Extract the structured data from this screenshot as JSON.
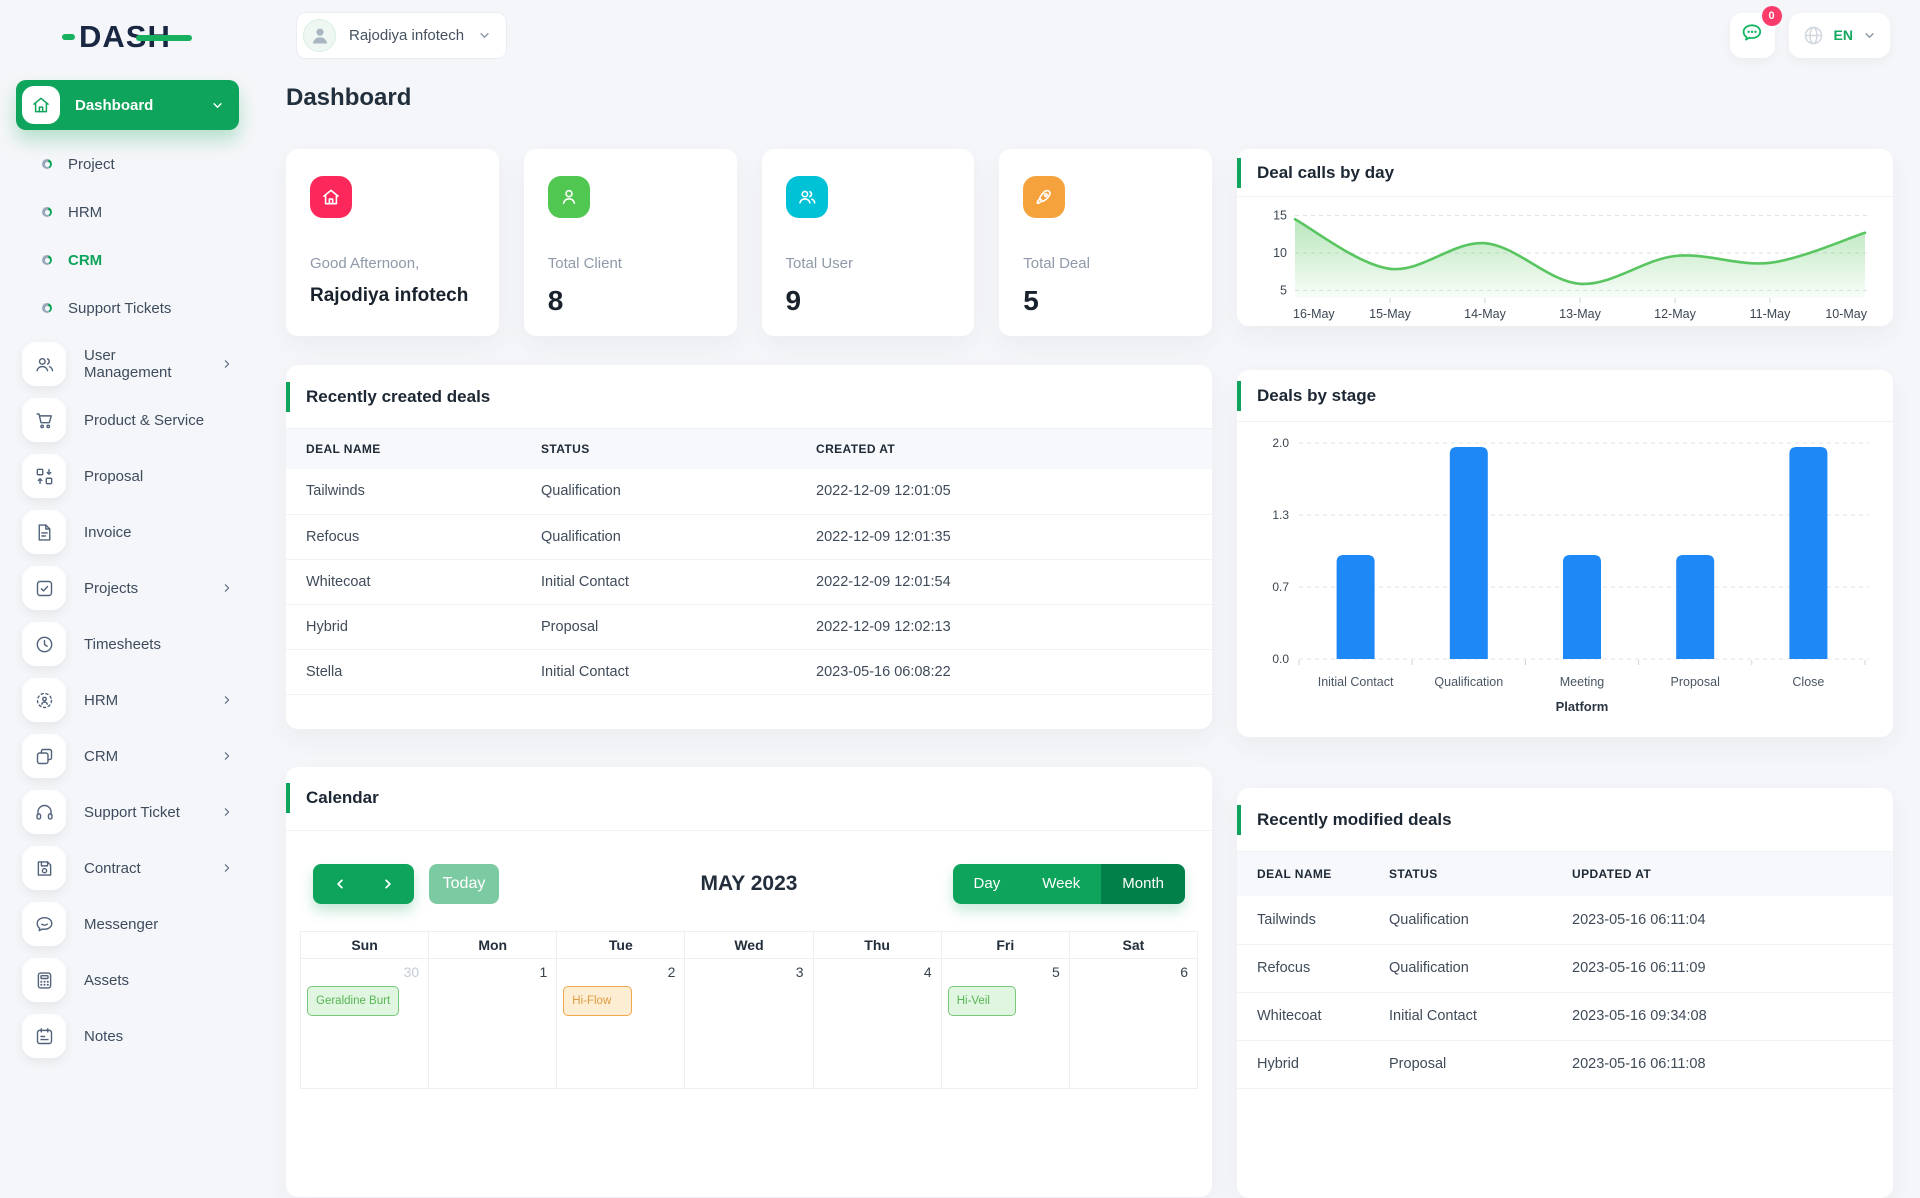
{
  "brand": {
    "logo_text": "DASH",
    "accent_color": "#17b05e",
    "text_color": "#1a2742"
  },
  "topbar": {
    "company": {
      "name": "Rajodiya infotech"
    },
    "messages_badge": "0",
    "language": {
      "code": "EN"
    }
  },
  "page": {
    "title": "Dashboard"
  },
  "sidebar": {
    "dashboard": {
      "label": "Dashboard",
      "icon": "home-icon",
      "expanded": true
    },
    "dashboard_children": [
      {
        "label": "Project",
        "active": false
      },
      {
        "label": "HRM",
        "active": false
      },
      {
        "label": "CRM",
        "active": true
      },
      {
        "label": "Support Tickets",
        "active": false
      }
    ],
    "items": [
      {
        "label": "User Management",
        "icon": "users-icon",
        "chevron": true
      },
      {
        "label": "Product & Service",
        "icon": "cart-icon",
        "chevron": false
      },
      {
        "label": "Proposal",
        "icon": "proposal-icon",
        "chevron": false
      },
      {
        "label": "Invoice",
        "icon": "invoice-icon",
        "chevron": false
      },
      {
        "label": "Projects",
        "icon": "projects-icon",
        "chevron": true
      },
      {
        "label": "Timesheets",
        "icon": "clock-icon",
        "chevron": false
      },
      {
        "label": "HRM",
        "icon": "hrm-icon",
        "chevron": true
      },
      {
        "label": "CRM",
        "icon": "crm-icon",
        "chevron": true
      },
      {
        "label": "Support Ticket",
        "icon": "headset-icon",
        "chevron": true
      },
      {
        "label": "Contract",
        "icon": "contract-icon",
        "chevron": true
      },
      {
        "label": "Messenger",
        "icon": "messenger-icon",
        "chevron": false
      },
      {
        "label": "Assets",
        "icon": "calculator-icon",
        "chevron": false
      },
      {
        "label": "Notes",
        "icon": "notes-icon",
        "chevron": false
      }
    ]
  },
  "stats": {
    "cards": [
      {
        "label": "Good Afternoon,",
        "value": "Rajodiya infotech",
        "icon": "home-icon",
        "color": "#fc275b",
        "small_value": true
      },
      {
        "label": "Total Client",
        "value": "8",
        "icon": "user-icon",
        "color": "#50c750",
        "small_value": false
      },
      {
        "label": "Total User",
        "value": "9",
        "icon": "users-icon",
        "color": "#00c2d7",
        "small_value": false
      },
      {
        "label": "Total Deal",
        "value": "5",
        "icon": "rocket-icon",
        "color": "#f5a23d",
        "small_value": false
      }
    ]
  },
  "created_deals": {
    "title": "Recently created deals",
    "columns": [
      "DEAL NAME",
      "STATUS",
      "CREATED AT"
    ],
    "col_widths": [
      "245px",
      "275px",
      ""
    ],
    "rows": [
      [
        "Tailwinds",
        "Qualification",
        "2022-12-09 12:01:05"
      ],
      [
        "Refocus",
        "Qualification",
        "2022-12-09 12:01:35"
      ],
      [
        "Whitecoat",
        "Initial Contact",
        "2022-12-09 12:01:54"
      ],
      [
        "Hybrid",
        "Proposal",
        "2022-12-09 12:02:13"
      ],
      [
        "Stella",
        "Initial Contact",
        "2023-05-16 06:08:22"
      ]
    ]
  },
  "modified_deals": {
    "title": "Recently modified deals",
    "columns": [
      "DEAL NAME",
      "STATUS",
      "UPDATED AT"
    ],
    "col_widths": [
      "142px",
      "183px",
      ""
    ],
    "rows": [
      [
        "Tailwinds",
        "Qualification",
        "2023-05-16 06:11:04"
      ],
      [
        "Refocus",
        "Qualification",
        "2023-05-16 06:11:09"
      ],
      [
        "Whitecoat",
        "Initial Contact",
        "2023-05-16 09:34:08"
      ],
      [
        "Hybrid",
        "Proposal",
        "2023-05-16 06:11:08"
      ]
    ]
  },
  "calendar": {
    "title": "Calendar",
    "today_label": "Today",
    "month_title": "MAY 2023",
    "views": [
      "Day",
      "Week",
      "Month"
    ],
    "active_view": "Month",
    "weekdays": [
      "Sun",
      "Mon",
      "Tue",
      "Wed",
      "Thu",
      "Fri",
      "Sat"
    ],
    "week1": [
      {
        "date": "30",
        "muted": true,
        "event": {
          "label": "Geraldine Burt",
          "type": "green"
        }
      },
      {
        "date": "1",
        "muted": false,
        "event": null
      },
      {
        "date": "2",
        "muted": false,
        "event": {
          "label": "Hi-Flow",
          "type": "orange"
        }
      },
      {
        "date": "3",
        "muted": false,
        "event": null
      },
      {
        "date": "4",
        "muted": false,
        "event": null
      },
      {
        "date": "5",
        "muted": false,
        "event": {
          "label": "Hi-Veil",
          "type": "green"
        }
      },
      {
        "date": "6",
        "muted": false,
        "event": null
      }
    ],
    "event_colors": {
      "green": "#57b553",
      "orange": "#df9b40"
    }
  },
  "chart_data": [
    {
      "type": "area",
      "title": "Deal calls by day",
      "x": [
        "16-May",
        "15-May",
        "14-May",
        "13-May",
        "12-May",
        "11-May",
        "10-May"
      ],
      "values": [
        14.5,
        7.9,
        11.3,
        5.9,
        9.6,
        8.7,
        12.7
      ],
      "yticks": [
        5,
        10,
        15
      ],
      "ylim": [
        4,
        16
      ],
      "line_color": "#58c560",
      "grid": true,
      "legend": false
    },
    {
      "type": "bar",
      "title": "Deals by stage",
      "categories": [
        "Initial Contact",
        "Qualification",
        "Meeting",
        "Proposal",
        "Close"
      ],
      "values": [
        1,
        2,
        1,
        1,
        2
      ],
      "ytick_labels": [
        "0.0",
        "0.7",
        "1.3",
        "2.0"
      ],
      "ylim": [
        0,
        2
      ],
      "xlabel": "Platform",
      "bar_color": "#1e88f7",
      "grid": true,
      "legend": false
    }
  ]
}
